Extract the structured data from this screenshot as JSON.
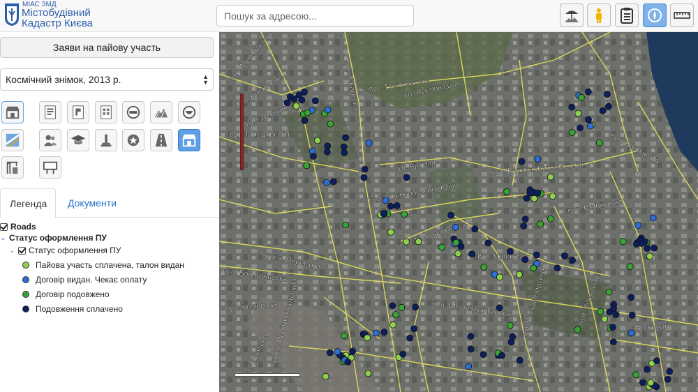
{
  "header": {
    "brand_small": "МІАС ЗМД",
    "brand_line1": "Містобудівний",
    "brand_line2": "Кадастр Києва",
    "search_placeholder": "Пошук за адресою..."
  },
  "toolbar": {
    "tools": [
      {
        "icon": "landscape-umbrella-icon",
        "active": false
      },
      {
        "icon": "person-icon",
        "active": false
      },
      {
        "icon": "clipboard-icon",
        "active": false
      },
      {
        "icon": "compass-icon",
        "active": true
      },
      {
        "icon": "ruler-icon",
        "active": false
      }
    ]
  },
  "sidebar": {
    "primary_button": "Заяви на пайову участь",
    "basemap_select": {
      "value": "Космічний знімок, 2013 р."
    },
    "layer_icons": [
      "shop-icon",
      "map-page-icon",
      "puzzle-page-icon",
      "grid-page-icon",
      "no-entry-icon",
      "hills-icon",
      "ring-icon",
      "route-map-icon",
      "people-icon",
      "graduation-cap-icon",
      "monument-icon",
      "badge-icon",
      "road-icon",
      "shop-icon",
      "crane-icon",
      "billboard-icon"
    ],
    "tabs": [
      {
        "label": "Легенда",
        "active": true
      },
      {
        "label": "Документи",
        "active": false
      }
    ],
    "legend": {
      "roads_label": "Roads",
      "group_label": "Статус оформлення ПУ",
      "subgroup_label": "Статус оформлення ПУ",
      "items": [
        {
          "label": "Пайова участь сплачена, талон видан",
          "color": "#8fd14f"
        },
        {
          "label": "Договір видан. Чекає оплату",
          "color": "#2e6fd6"
        },
        {
          "label": "Договір подовжено",
          "color": "#3aa335"
        },
        {
          "label": "Подовження сплачено",
          "color": "#0d1e5c"
        }
      ]
    }
  },
  "map": {
    "street_labels": [
      "вул. Мельникова",
      "вул. Білоруська",
      "вул. Дегтярівська",
      "вул. Молдавська",
      "вул. Тагарська",
      "вул. Лук'янівська",
      "вул. Глибочицька",
      "вул. Артема",
      "вул. Велика Житомирська",
      "вул. Коцюбинського Юрія",
      "вул. Гончара Олеся",
      "вул. Чапаєва",
      "просп. Перемоги",
      "вул. Борщагівська",
      "бул. Шевченка Тараса",
      "вул. Уманська",
      "вул. Хрещатик",
      "вул. Круглі",
      "вул. Володимирська",
      "вул. Софіївська",
      "вул. Боричів Тік",
      "вул. Тополева",
      "просп. Повітрофлотський"
    ],
    "colors": {
      "paid": "#8fd14f",
      "awaiting": "#2e6fd6",
      "extended": "#3aa335",
      "extension_paid": "#0d1e5c"
    }
  }
}
